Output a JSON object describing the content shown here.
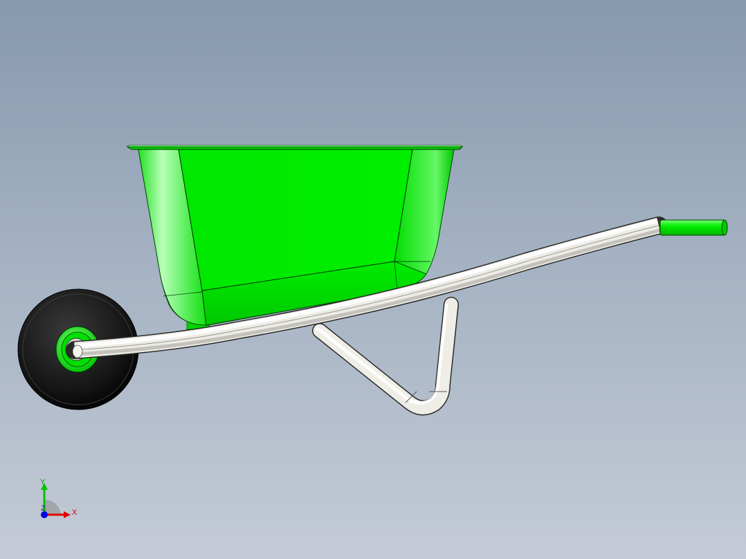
{
  "viewport": {
    "background_top": "#8799ae",
    "background_bottom": "#c4cbd6"
  },
  "model": {
    "name": "wheelbarrow",
    "tray_color": "#00ee00",
    "frame_color": "#f2f1ec",
    "handle_grip_color": "#00ee00",
    "tire_color": "#111111",
    "hub_color": "#00ee00"
  },
  "triad": {
    "x_label": "X",
    "y_label": "Y",
    "z_label": "Z",
    "x_color": "#e00000",
    "y_color": "#00c000",
    "z_color": "#0000e0"
  }
}
